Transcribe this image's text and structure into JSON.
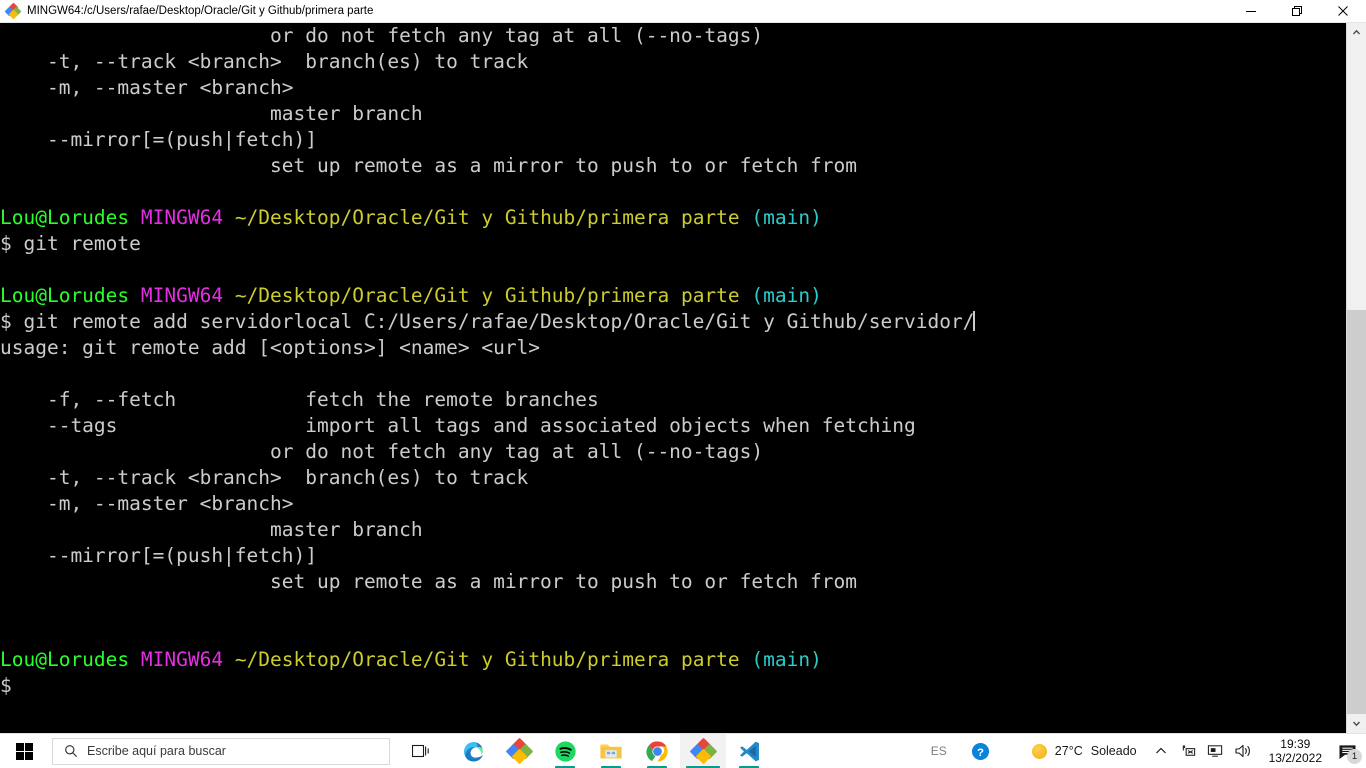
{
  "window": {
    "title": "MINGW64:/c/Users/rafae/Desktop/Oracle/Git y Github/primera parte",
    "icon": "git-bash-icon",
    "minimize_label": "—",
    "restore_label": "❐",
    "close_label": "✕"
  },
  "terminal": {
    "prompt_user": "Lou@Lorudes",
    "prompt_shell": "MINGW64",
    "prompt_path": "~/Desktop/Oracle/Git y Github/primera parte",
    "prompt_branch": "(main)",
    "dollar": "$",
    "colors": {
      "background": "#000000",
      "foreground": "#cccccc",
      "user": "#29ff2a",
      "shell": "#e32ee3",
      "path": "#cccc2e",
      "branch": "#29cccc"
    },
    "lines": [
      {
        "type": "plain",
        "text": "                       or do not fetch any tag at all (--no-tags)"
      },
      {
        "type": "plain",
        "text": "    -t, --track <branch>  branch(es) to track"
      },
      {
        "type": "plain",
        "text": "    -m, --master <branch>"
      },
      {
        "type": "plain",
        "text": "                       master branch"
      },
      {
        "type": "plain",
        "text": "    --mirror[=(push|fetch)]"
      },
      {
        "type": "plain",
        "text": "                       set up remote as a mirror to push to or fetch from"
      },
      {
        "type": "plain",
        "text": ""
      },
      {
        "type": "prompt"
      },
      {
        "type": "plain",
        "text": "$ git remote"
      },
      {
        "type": "plain",
        "text": ""
      },
      {
        "type": "prompt"
      },
      {
        "type": "command",
        "text": "$ git remote add servidorlocal C:/Users/rafae/Desktop/Oracle/Git y Github/servidor/"
      },
      {
        "type": "plain",
        "text": "usage: git remote add [<options>] <name> <url>"
      },
      {
        "type": "plain",
        "text": ""
      },
      {
        "type": "plain",
        "text": "    -f, --fetch           fetch the remote branches"
      },
      {
        "type": "plain",
        "text": "    --tags                import all tags and associated objects when fetching"
      },
      {
        "type": "plain",
        "text": "                       or do not fetch any tag at all (--no-tags)"
      },
      {
        "type": "plain",
        "text": "    -t, --track <branch>  branch(es) to track"
      },
      {
        "type": "plain",
        "text": "    -m, --master <branch>"
      },
      {
        "type": "plain",
        "text": "                       master branch"
      },
      {
        "type": "plain",
        "text": "    --mirror[=(push|fetch)]"
      },
      {
        "type": "plain",
        "text": "                       set up remote as a mirror to push to or fetch from"
      },
      {
        "type": "plain",
        "text": ""
      },
      {
        "type": "plain",
        "text": ""
      },
      {
        "type": "prompt"
      },
      {
        "type": "plain",
        "text": "$"
      }
    ]
  },
  "scrollbar": {
    "up_arrow": "chevron-up-icon",
    "down_arrow": "chevron-down-icon"
  },
  "taskbar": {
    "start_label": "start-button",
    "search_placeholder": "Escribe aquí para buscar",
    "task_view_label": "task-view-button",
    "apps": [
      {
        "name": "microsoft-edge",
        "running": false,
        "active": false
      },
      {
        "name": "git-bash",
        "running": false,
        "active": false
      },
      {
        "name": "spotify",
        "running": true,
        "active": false
      },
      {
        "name": "file-explorer",
        "running": true,
        "active": false
      },
      {
        "name": "google-chrome",
        "running": true,
        "active": false
      },
      {
        "name": "git-bash-window",
        "running": true,
        "active": true
      },
      {
        "name": "visual-studio-code",
        "running": true,
        "active": false
      }
    ],
    "tray": {
      "language": "ES",
      "help_icon": "help-circle-icon",
      "weather_temp": "27°C",
      "weather_desc": "Soleado",
      "weather_icon": "sun-icon",
      "show_hidden_icon": "chevron-up-icon",
      "network_icon": "network-error-icon",
      "display_icon": "monitor-icon",
      "volume_icon": "speaker-icon",
      "time": "19:39",
      "date": "13/2/2022",
      "notifications_icon": "notification-icon",
      "notifications_count": "1"
    }
  }
}
